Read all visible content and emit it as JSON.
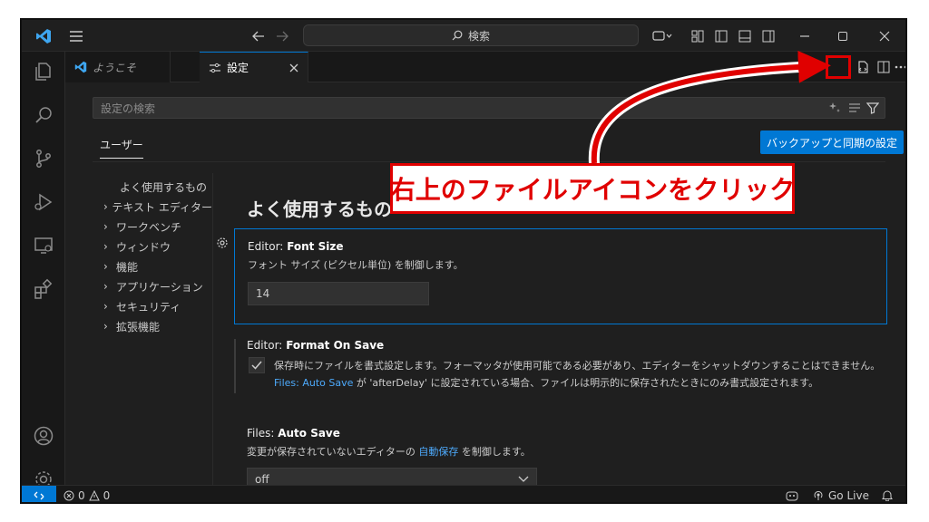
{
  "titlebar": {
    "search_label": "検索"
  },
  "tabs": [
    {
      "label": "ようこそ"
    },
    {
      "label": "設定"
    }
  ],
  "settings_page": {
    "search_placeholder": "設定の検索",
    "scope_tab": "ユーザー",
    "sync_button": "バックアップと同期の設定",
    "toc": [
      "よく使用するもの",
      "テキスト エディター",
      "ワークベンチ",
      "ウィンドウ",
      "機能",
      "アプリケーション",
      "セキュリティ",
      "拡張機能"
    ],
    "section_title": "よく使用するもの",
    "font_size": {
      "category": "Editor:",
      "name": "Font Size",
      "description": "フォント サイズ (ピクセル単位) を制御します。",
      "value": "14"
    },
    "format_on_save": {
      "category": "Editor:",
      "name": "Format On Save",
      "description_1": "保存時にファイルを書式設定します。フォーマッタが使用可能である必要があり、エディターをシャットダウンすることはできません。",
      "link": "Files: Auto Save",
      "description_2": "が 'afterDelay' に設定されている場合、ファイルは明示的に保存されたときにのみ書式設定されます。",
      "checked": true
    },
    "auto_save": {
      "category": "Files:",
      "name": "Auto Save",
      "description_1": "変更が保存されていないエディターの",
      "link": "自動保存",
      "description_2": "を制御します。",
      "value": "off"
    }
  },
  "statusbar": {
    "errors": "0",
    "warnings": "0",
    "go_live": "Go Live"
  },
  "annotation": {
    "callout": "右上のファイルアイコンをクリック",
    "color": "#e00000"
  },
  "colors": {
    "accent": "#0078d4",
    "link": "#4daafc"
  }
}
